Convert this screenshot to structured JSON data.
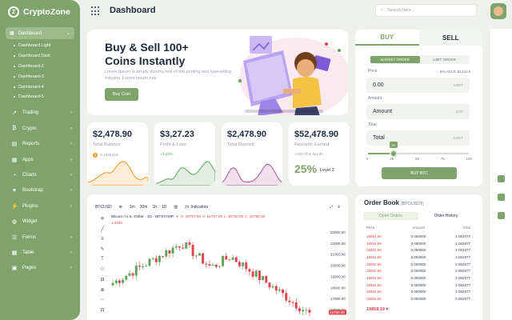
{
  "app": {
    "name": "CryptoZone"
  },
  "header": {
    "title": "Dashboard",
    "search_placeholder": "Search here..."
  },
  "sidebar": {
    "active": {
      "label": "Dashboard"
    },
    "sub_items": [
      "Dashboard Light",
      "Dashboard Dark",
      "Dashboard-2",
      "Dashboard-3",
      "Dashboard-4",
      "Dashboard-5"
    ],
    "items": [
      {
        "label": "Trading",
        "icon": "chart-line-icon"
      },
      {
        "label": "Crypto",
        "icon": "coin-icon"
      },
      {
        "label": "Reports",
        "icon": "file-icon"
      },
      {
        "label": "Apps",
        "icon": "apps-icon"
      },
      {
        "label": "Charts",
        "icon": "pie-chart-icon"
      },
      {
        "label": "Bootstrap",
        "icon": "heart-icon"
      },
      {
        "label": "Plugins",
        "icon": "plug-icon"
      },
      {
        "label": "Widget",
        "icon": "widget-icon"
      },
      {
        "label": "Forms",
        "icon": "form-icon"
      },
      {
        "label": "Table",
        "icon": "table-icon"
      },
      {
        "label": "Pages",
        "icon": "pages-icon"
      }
    ]
  },
  "hero": {
    "title": "Buy & Sell 100+ Coins Instantly",
    "description": "Lorem Ipsum is simply dummy text of the printing and typesetting industry. Lorem Ipsum has",
    "button": "Buy Coin"
  },
  "stats": [
    {
      "value": "$2,478.90",
      "label": "Total Balance",
      "sub": "0.1985419",
      "color": "#f7931a"
    },
    {
      "value": "$3,27.23",
      "label": "Profit & Loss",
      "sub": "+3.02%",
      "color": "#5fa35a"
    },
    {
      "value": "$2,478.90",
      "label": "Total Deposit",
      "sub": "",
      "color": "#a6558f"
    },
    {
      "value": "$52,478.90",
      "label": "Rewards Earned",
      "sub": "+200 This Month",
      "pct": "25%",
      "level": "Level 2"
    }
  ],
  "chart": {
    "symbol": "BTCUSD",
    "intervals": [
      "1m",
      "30m",
      "1h",
      "1D"
    ],
    "indicators_label": "Indicators",
    "title": "Bitcoin / U.S. Dollar - 1D - BITSTAMP",
    "ohlc": [
      "O",
      "15757.00",
      "H",
      "15757.00",
      "L",
      "15760.00",
      "C",
      "15760.00"
    ],
    "change": "1.3338",
    "y_ticks": [
      "23000.00",
      "22000.00",
      "21000.00",
      "20000.00",
      "19000.00",
      "18000.00",
      "17000.00",
      "16000.00"
    ],
    "current_price": "15760.00"
  },
  "chart_data": {
    "type": "candlestick",
    "title": "Bitcoin / U.S. Dollar - 1D - BITSTAMP",
    "y_ticks": [
      "23000.00",
      "22000.00",
      "21000.00",
      "20000.00",
      "19000.00",
      "18000.00",
      "17000.00",
      "16000.00"
    ],
    "ylim": [
      15500,
      23500
    ]
  },
  "trade": {
    "tabs": [
      "BUY",
      "SELL"
    ],
    "order_types": [
      "MARKET ORDER",
      "LIMIT ORDER"
    ],
    "price_label": "Price",
    "balance": "BALANCE: $3,123.5",
    "price_value": "0.00",
    "price_unit": "USDT",
    "amount_label": "Amount",
    "amount_value": "Amount",
    "amount_unit": "BTC",
    "total_label": "Total",
    "total_value": "Total",
    "total_unit": "USDT",
    "slider_value": "25",
    "slider_pct": 0.25,
    "slider_ticks": [
      "0",
      "25",
      "50",
      "75",
      "100"
    ],
    "button": "BUY BTC"
  },
  "orderbook": {
    "title": "Order Book",
    "pair": "(BTC/USDT)",
    "tabs": [
      "Open Orders",
      "Order History"
    ],
    "columns": [
      "Price",
      "Amount",
      "Total"
    ],
    "rows": [
      [
        "16852.65",
        "0.050000",
        "2.062877"
      ],
      [
        "16852.65",
        "0.050000",
        "2.062877"
      ],
      [
        "16852.65",
        "0.050000",
        "2.062877"
      ],
      [
        "16852.65",
        "0.050000",
        "2.062877"
      ],
      [
        "16852.65",
        "0.050000",
        "2.062877"
      ],
      [
        "16852.65",
        "0.050000",
        "2.062877"
      ],
      [
        "16852.65",
        "0.050000",
        "2.062877"
      ],
      [
        "16852.65",
        "0.050000",
        "2.062877"
      ],
      [
        "16852.65",
        "0.050000",
        "2.062877"
      ],
      [
        "16852.65",
        "0.050000",
        "2.062877"
      ]
    ],
    "current": "19858.19 ▾"
  },
  "colors": {
    "accent": "#7ea46b",
    "up": "#5fa35a",
    "down": "#e0434b"
  }
}
